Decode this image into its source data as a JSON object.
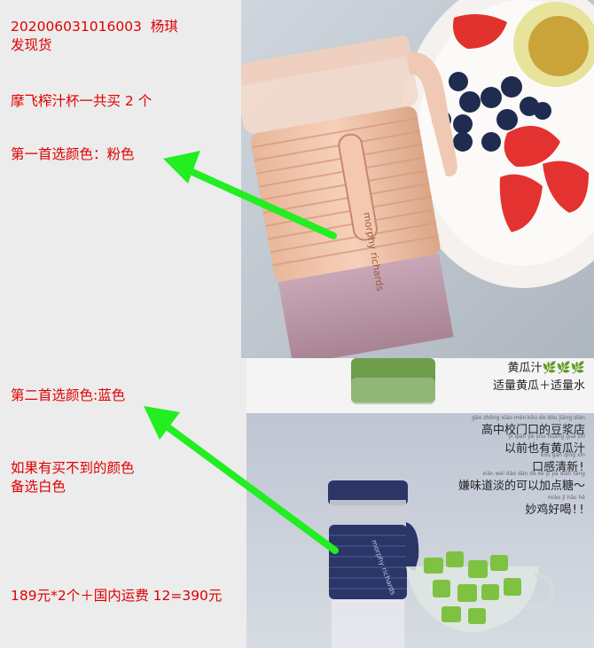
{
  "order": {
    "id_line": "202006031016003  杨琪",
    "status": "发现货",
    "product": "摩飞榨汁杯一共买 2 个",
    "first_choice": "第一首选颜色：粉色",
    "second_choice": "第二首选颜色:蓝色",
    "fallback_line1": "如果有买不到的颜色",
    "fallback_line2": "备选白色",
    "total": "189元*2个＋国内运费 12=390元"
  },
  "photo_top": {
    "cup_brand": "morphy richards"
  },
  "photo_bottom": {
    "cup_brand": "morphy richards",
    "caption_lines": [
      "黄瓜汁🌿🌿🌿",
      "适量黄瓜＋适量水",
      "高中校门口的豆浆店",
      "以前也有黄瓜汁",
      "口感清新!",
      "嫌味道淡的可以加点糖～",
      "妙鸡好喝!!"
    ],
    "pinyin_lines": [
      "gāo zhōng xiào mén kǒu de dòu jiāng diàn",
      "yǐ qián yě yǒu huáng guā zhī",
      "kǒu gǎn qīng xīn",
      "xián wèi dào dàn de kě yǐ jiā diǎn táng",
      "miào jī hǎo hē"
    ]
  },
  "colors": {
    "note_text": "#e00000",
    "arrow": "#22ee22",
    "cup_pink": "#f2c4a8",
    "cup_blue": "#2b3566"
  }
}
